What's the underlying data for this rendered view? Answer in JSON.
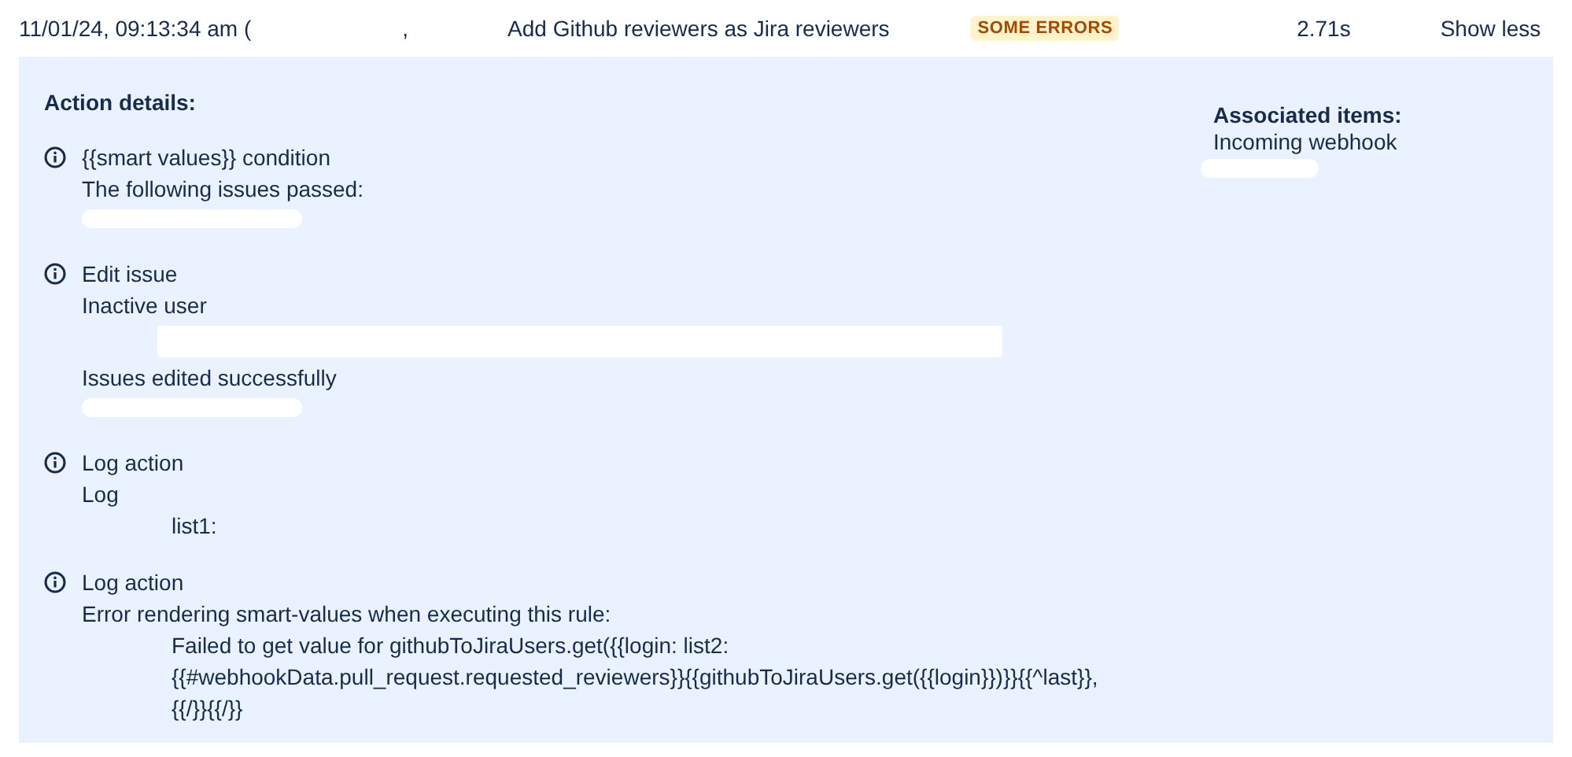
{
  "header": {
    "timestamp": "11/01/24, 09:13:34 am (",
    "timestamp_tail": ",",
    "rule": "Add Github reviewers as Jira reviewers",
    "status": "SOME ERRORS",
    "duration": "2.71s",
    "toggle": "Show less"
  },
  "details": {
    "heading": "Action details:",
    "actions": [
      {
        "title": "{{smart values}} condition",
        "lines": [
          {
            "kind": "message",
            "text": "The following issues passed:"
          },
          {
            "kind": "blot"
          }
        ]
      },
      {
        "title": "Edit issue",
        "lines": [
          {
            "kind": "message",
            "text": "Inactive user"
          },
          {
            "kind": "bar"
          },
          {
            "kind": "message",
            "text": "Issues edited successfully"
          },
          {
            "kind": "blot"
          }
        ]
      },
      {
        "title": "Log action",
        "lines": [
          {
            "kind": "message",
            "text": "Log"
          },
          {
            "kind": "detail",
            "text": "list1:"
          }
        ]
      },
      {
        "title": "Log action",
        "lines": [
          {
            "kind": "message",
            "text": "Error rendering smart-values when executing this rule:"
          },
          {
            "kind": "detail",
            "text": "Failed to get value for githubToJiraUsers.get({{login: list2:\n{{#webhookData.pull_request.requested_reviewers}}{{githubToJiraUsers.get({{login}})}}{{^last}},\n{{/}}{{/}}"
          }
        ]
      }
    ]
  },
  "associated": {
    "heading": "Associated items:",
    "items": [
      {
        "kind": "message",
        "text": "Incoming webhook"
      },
      {
        "kind": "blot"
      }
    ]
  }
}
